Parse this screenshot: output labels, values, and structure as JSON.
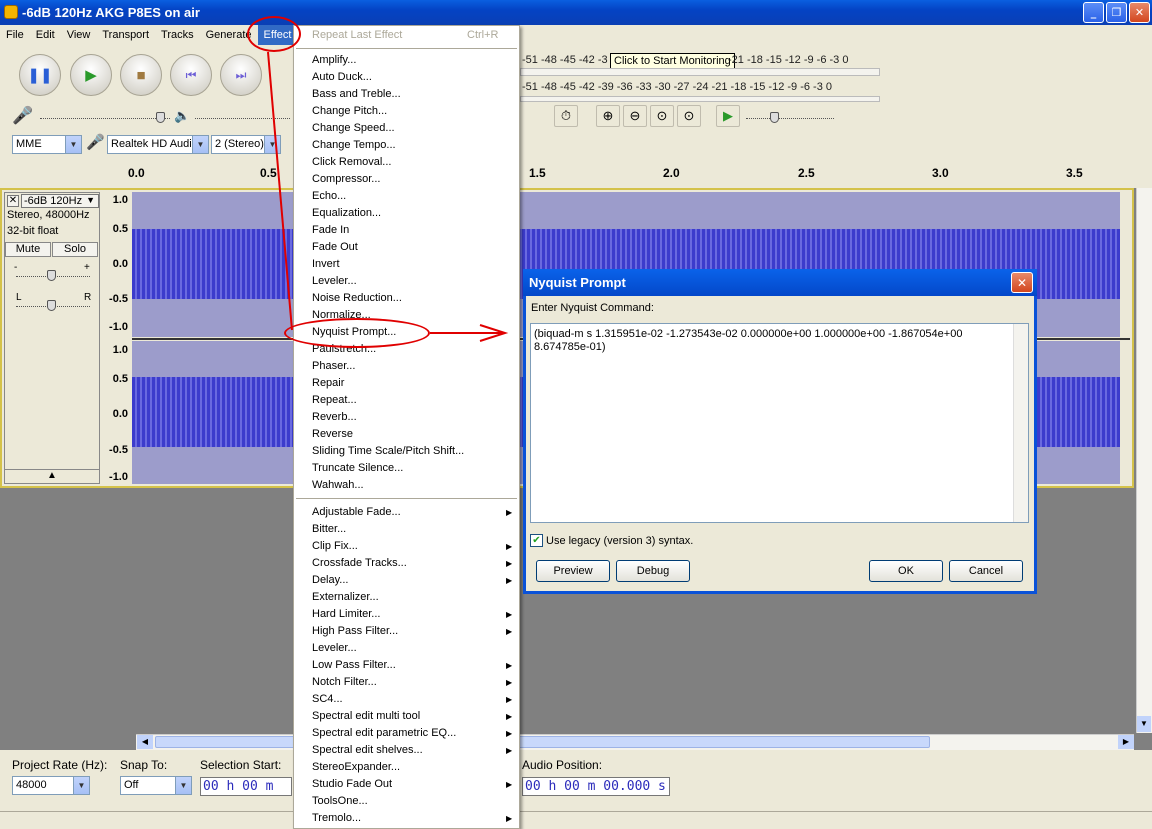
{
  "window": {
    "title": "-6dB 120Hz AKG P8ES on air"
  },
  "menubar": [
    "File",
    "Edit",
    "View",
    "Transport",
    "Tracks",
    "Generate",
    "Effect"
  ],
  "meter": {
    "tooltip": "Click to Start Monitoring",
    "scale_left": "-51 -48 -45 -42 -3",
    "scale_right": "-21 -18 -15 -12 -9 -6 -3 0",
    "scale2": "-51 -48 -45 -42 -39 -36 -33 -30 -27 -24 -21 -18 -15 -12 -9 -6 -3 0"
  },
  "device": {
    "host": "MME",
    "input": "Realtek HD Audio",
    "channels": "2 (Stereo)"
  },
  "ruler": [
    "0.0",
    "0.5",
    "1.5",
    "2.0",
    "2.5",
    "3.0",
    "3.5"
  ],
  "track": {
    "name": "-6dB 120Hz",
    "info1": "Stereo, 48000Hz",
    "info2": "32-bit float",
    "mute": "Mute",
    "solo": "Solo",
    "gain_minus": "-",
    "gain_plus": "+",
    "pan_l": "L",
    "pan_r": "R",
    "y_top": [
      "1.0",
      "0.5",
      "0.0",
      "-0.5",
      "-1.0"
    ],
    "y_bottom": [
      "1.0",
      "0.5",
      "0.0",
      "-0.5",
      "-1.0"
    ]
  },
  "bottom": {
    "rate_label": "Project Rate (Hz):",
    "rate_value": "48000",
    "snap_label": "Snap To:",
    "snap_value": "Off",
    "sel_label": "Selection Start:",
    "sel_value": "00 h 00 m",
    "audio_label": "Audio Position:",
    "audio_value": "00 h 00 m 00.000 s"
  },
  "effect_menu": {
    "repeat": "Repeat Last Effect",
    "repeat_shortcut": "Ctrl+R",
    "group1": [
      "Amplify...",
      "Auto Duck...",
      "Bass and Treble...",
      "Change Pitch...",
      "Change Speed...",
      "Change Tempo...",
      "Click Removal...",
      "Compressor...",
      "Echo...",
      "Equalization...",
      "Fade In",
      "Fade Out",
      "Invert",
      "Leveler...",
      "Noise Reduction...",
      "Normalize...",
      "Nyquist Prompt...",
      "Paulstretch...",
      "Phaser...",
      "Repair",
      "Repeat...",
      "Reverb...",
      "Reverse",
      "Sliding Time Scale/Pitch Shift...",
      "Truncate Silence...",
      "Wahwah..."
    ],
    "group2": [
      {
        "label": "Adjustable Fade...",
        "sub": true
      },
      {
        "label": "Bitter...",
        "sub": false
      },
      {
        "label": "Clip Fix...",
        "sub": true
      },
      {
        "label": "Crossfade Tracks...",
        "sub": true
      },
      {
        "label": "Delay...",
        "sub": true
      },
      {
        "label": "Externalizer...",
        "sub": false
      },
      {
        "label": "Hard Limiter...",
        "sub": true
      },
      {
        "label": "High Pass Filter...",
        "sub": true
      },
      {
        "label": "Leveler...",
        "sub": false
      },
      {
        "label": "Low Pass Filter...",
        "sub": true
      },
      {
        "label": "Notch Filter...",
        "sub": true
      },
      {
        "label": "SC4...",
        "sub": true
      },
      {
        "label": "Spectral edit multi tool",
        "sub": true
      },
      {
        "label": "Spectral edit parametric EQ...",
        "sub": true
      },
      {
        "label": "Spectral edit shelves...",
        "sub": true
      },
      {
        "label": "StereoExpander...",
        "sub": false
      },
      {
        "label": "Studio Fade Out",
        "sub": true
      },
      {
        "label": "ToolsOne...",
        "sub": false
      },
      {
        "label": "Tremolo...",
        "sub": true
      }
    ]
  },
  "dialog": {
    "title": "Nyquist Prompt",
    "prompt_label": "Enter Nyquist Command:",
    "command": "(biquad-m s 1.315951e-02 -1.273543e-02 0.000000e+00 1.000000e+00 -1.867054e+00 8.674785e-01)",
    "legacy_label": "Use legacy (version 3) syntax.",
    "preview": "Preview",
    "debug": "Debug",
    "ok": "OK",
    "cancel": "Cancel"
  },
  "icons": {
    "pause": "pause-icon",
    "play": "play-icon",
    "stop": "stop-icon",
    "skip_start": "skip-start-icon",
    "skip_end": "skip-end-icon"
  }
}
